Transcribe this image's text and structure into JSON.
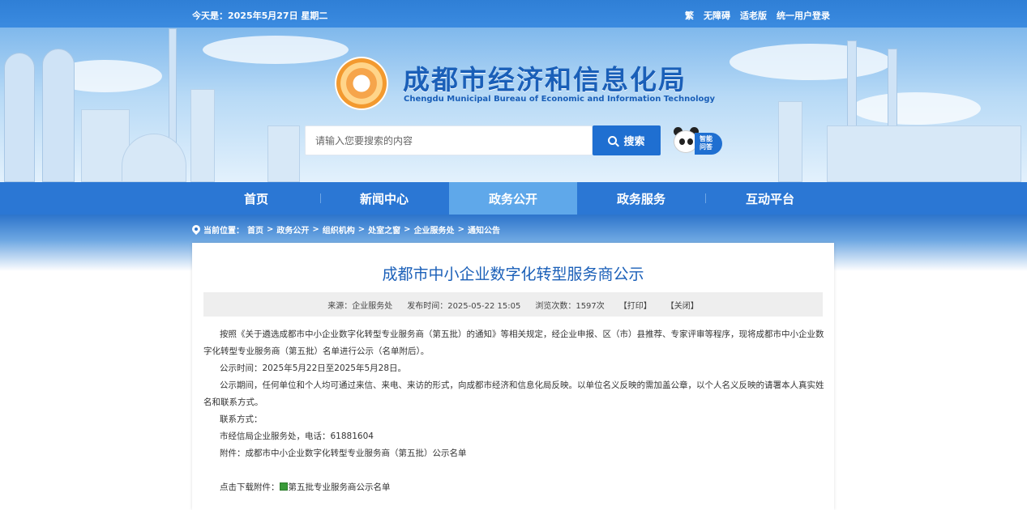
{
  "topbar": {
    "date": "今天是：2025年5月27日  星期二",
    "links": [
      "繁",
      "无障碍",
      "适老版",
      "统一用户登录"
    ]
  },
  "header": {
    "title": "成都市经济和信息化局",
    "subtitle": "Chengdu Municipal Bureau of Economic and Information Technology"
  },
  "search": {
    "placeholder": "请输入您要搜索的内容",
    "button_label": "搜索",
    "assistant_label_1": "智能",
    "assistant_label_2": "问答"
  },
  "nav": {
    "items": [
      "首页",
      "新闻中心",
      "政务公开",
      "政务服务",
      "互动平台"
    ],
    "active": "政务公开"
  },
  "breadcrumb": {
    "label": "当前位置：",
    "items": [
      "首页",
      "政务公开",
      "组织机构",
      "处室之窗",
      "企业服务处",
      "通知公告"
    ],
    "separator": ">"
  },
  "article": {
    "title": "成都市中小企业数字化转型服务商公示",
    "meta": {
      "source": "来源：企业服务处",
      "published": "发布时间：2025-05-22 15:05",
      "views": "浏览次数：1597次",
      "print": "【打印】",
      "close": "【关闭】"
    },
    "paragraphs": {
      "p1": "按照《关于遴选成都市中小企业数字化转型专业服务商（第五批）的通知》等相关规定，经企业申报、区（市）县推荐、专家评审等程序，现将成都市中小企业数字化转型专业服务商（第五批）名单进行公示（名单附后）。",
      "p2": "公示时间：2025年5月22日至2025年5月28日。",
      "p3": "公示期间，任何单位和个人均可通过来信、来电、来访的形式，向成都市经济和信息化局反映。以单位名义反映的需加盖公章，以个人名义反映的请署本人真实姓名和联系方式。",
      "p4": "联系方式：",
      "p5": "市经信局企业服务处，电话：61881604",
      "p6": "附件：成都市中小企业数字化转型专业服务商（第五批）公示名单",
      "download_label": "点击下载附件：",
      "download_link": "第五批专业服务商公示名单"
    }
  },
  "colors": {
    "topbar": "#2f7fd6",
    "nav": "#2b77d4",
    "nav_active": "#5fa8ea",
    "title": "#1a5fb8",
    "search_button": "#1f6fd1"
  }
}
